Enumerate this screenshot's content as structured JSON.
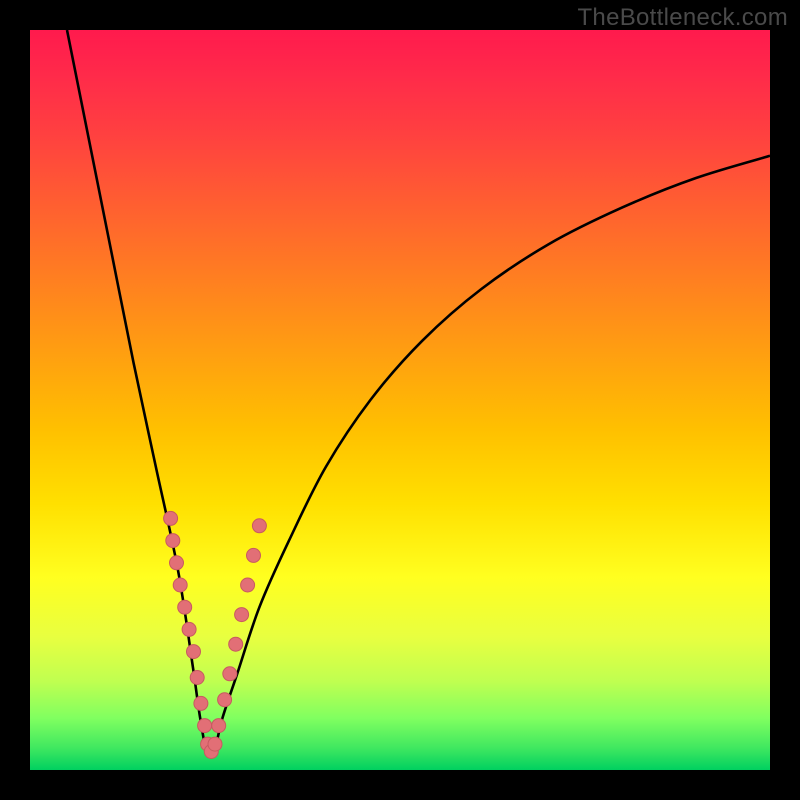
{
  "watermark": "TheBottleneck.com",
  "colors": {
    "background": "#000000",
    "curve_stroke": "#000000",
    "marker_fill": "#e26f76",
    "marker_stroke": "#c85a60"
  },
  "chart_data": {
    "type": "line",
    "title": "",
    "xlabel": "",
    "ylabel": "",
    "xlim": [
      0,
      100
    ],
    "ylim": [
      0,
      100
    ],
    "notes": "V-shaped bottleneck curve. x is an implicit performance-ratio axis; y is bottleneck percentage (0 = no bottleneck at bottom, 100 = severe at top). Minimum of the curve sits near x≈24. Left branch is steep and near-linear; right branch rises with decreasing slope (concave). Salmon circular markers (data points) cluster on both branches roughly between y≈3 and y≈35.",
    "series": [
      {
        "name": "bottleneck-curve",
        "x": [
          5,
          8,
          11,
          14,
          17,
          20,
          22,
          23,
          24,
          25,
          26,
          28,
          31,
          35,
          40,
          46,
          53,
          61,
          70,
          80,
          90,
          100
        ],
        "y": [
          100,
          85,
          70,
          55,
          41,
          27,
          14,
          7,
          2,
          3,
          7,
          13,
          22,
          31,
          41,
          50,
          58,
          65,
          71,
          76,
          80,
          83
        ]
      }
    ],
    "markers": {
      "name": "sample-points",
      "x": [
        19.0,
        19.3,
        19.8,
        20.3,
        20.9,
        21.5,
        22.1,
        22.6,
        23.1,
        23.6,
        24.0,
        24.5,
        25.0,
        25.5,
        26.3,
        27.0,
        27.8,
        28.6,
        29.4,
        30.2,
        31.0
      ],
      "y": [
        34.0,
        31.0,
        28.0,
        25.0,
        22.0,
        19.0,
        16.0,
        12.5,
        9.0,
        6.0,
        3.5,
        2.5,
        3.5,
        6.0,
        9.5,
        13.0,
        17.0,
        21.0,
        25.0,
        29.0,
        33.0
      ]
    }
  }
}
